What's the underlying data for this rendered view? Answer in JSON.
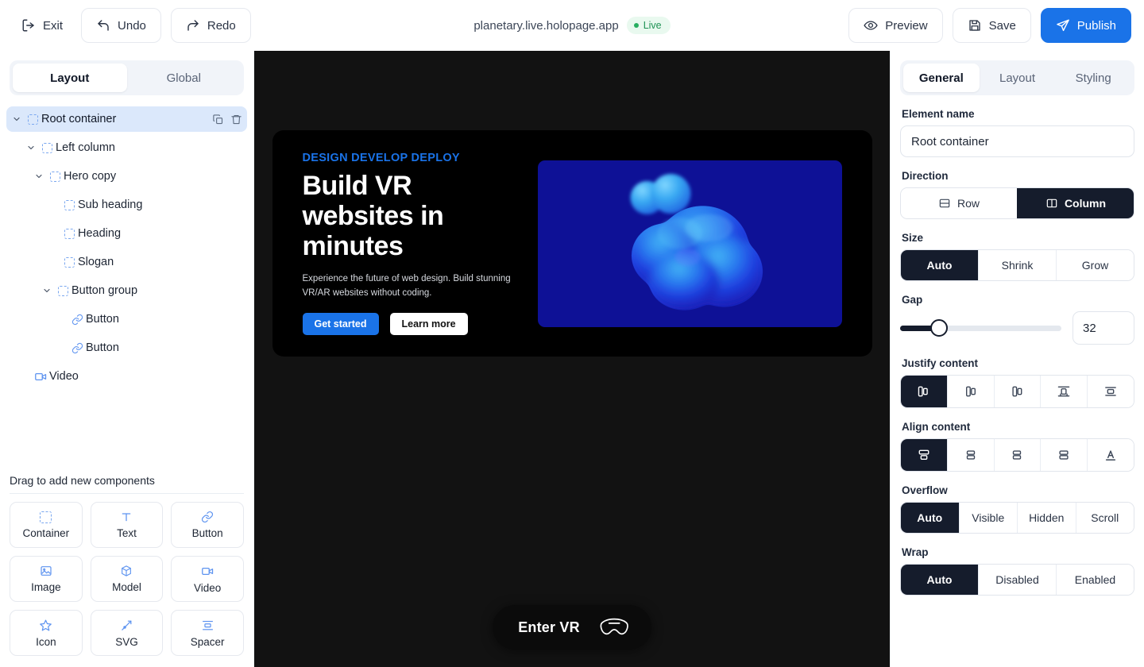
{
  "topbar": {
    "exit_label": "Exit",
    "undo_label": "Undo",
    "redo_label": "Redo",
    "url": "planetary.live.holopage.app",
    "live_label": "Live",
    "preview_label": "Preview",
    "save_label": "Save",
    "publish_label": "Publish",
    "accent": "#1a73e8",
    "live_color": "#1f9254"
  },
  "left_panel": {
    "tabs": [
      {
        "label": "Layout",
        "active": true
      },
      {
        "label": "Global",
        "active": false
      }
    ],
    "tree": [
      {
        "label": "Root container",
        "icon": "container-icon",
        "depth": 0,
        "caret": "chevron-down-icon",
        "selected": true,
        "actions": [
          "duplicate-icon",
          "delete-icon"
        ]
      },
      {
        "label": "Left column",
        "icon": "container-icon",
        "depth": 1,
        "caret": "chevron-down-icon",
        "selected": false
      },
      {
        "label": "Hero copy",
        "icon": "container-icon",
        "depth": 2,
        "caret": "chevron-down-icon",
        "selected": false
      },
      {
        "label": "Sub heading",
        "icon": "container-icon",
        "depth": 3,
        "caret": "",
        "selected": false
      },
      {
        "label": "Heading",
        "icon": "container-icon",
        "depth": 3,
        "caret": "",
        "selected": false
      },
      {
        "label": "Slogan",
        "icon": "container-icon",
        "depth": 3,
        "caret": "",
        "selected": false
      },
      {
        "label": "Button group",
        "icon": "container-icon",
        "depth": 2,
        "caret": "chevron-down-icon",
        "selected": false
      },
      {
        "label": "Button",
        "icon": "link-icon",
        "depth": 3,
        "caret": "",
        "selected": false
      },
      {
        "label": "Button",
        "icon": "link-icon",
        "depth": 3,
        "caret": "",
        "selected": false
      },
      {
        "label": "Video",
        "icon": "video-icon",
        "depth": 0,
        "caret": "",
        "selected": false
      }
    ],
    "add_components": {
      "title": "Drag to add new components",
      "items": [
        {
          "label": "Container",
          "icon": "container-icon"
        },
        {
          "label": "Text",
          "icon": "text-icon"
        },
        {
          "label": "Button",
          "icon": "link-icon"
        },
        {
          "label": "Image",
          "icon": "image-icon"
        },
        {
          "label": "Model",
          "icon": "cube-icon"
        },
        {
          "label": "Video",
          "icon": "video-icon"
        },
        {
          "label": "Icon",
          "icon": "star-icon"
        },
        {
          "label": "SVG",
          "icon": "pen-icon"
        },
        {
          "label": "Spacer",
          "icon": "spacer-icon"
        }
      ]
    }
  },
  "canvas": {
    "background": "#121212",
    "hero": {
      "card_background": "#000000",
      "eyebrow": "DESIGN DEVELOP DEPLOY",
      "heading": "Build VR websites in minutes",
      "slogan": "Experience the future of web design. Build stunning VR/AR websites without coding.",
      "primary_button": "Get started",
      "secondary_button": "Learn more",
      "media_background": "#0e1196",
      "media_alt": "blue-3d-blob"
    },
    "enter_vr": {
      "label": "Enter VR",
      "icon": "vr-headset-icon"
    }
  },
  "right_panel": {
    "tabs": [
      {
        "label": "General",
        "active": true
      },
      {
        "label": "Layout",
        "active": false
      },
      {
        "label": "Styling",
        "active": false
      }
    ],
    "element_name": {
      "label": "Element name",
      "value": "Root container",
      "placeholder": "Element name"
    },
    "direction": {
      "label": "Direction",
      "options": [
        {
          "label": "Row",
          "icon": "row-icon",
          "active": false
        },
        {
          "label": "Column",
          "icon": "column-icon",
          "active": true
        }
      ]
    },
    "size": {
      "label": "Size",
      "options": [
        {
          "label": "Auto",
          "active": true
        },
        {
          "label": "Shrink",
          "active": false
        },
        {
          "label": "Grow",
          "active": false
        }
      ]
    },
    "gap": {
      "label": "Gap",
      "value": "32",
      "percent": 24
    },
    "justify_content": {
      "label": "Justify content",
      "options": [
        {
          "icon": "justify-start-icon",
          "active": true
        },
        {
          "icon": "justify-center-icon",
          "active": false
        },
        {
          "icon": "justify-end-icon",
          "active": false
        },
        {
          "icon": "justify-between-icon",
          "active": false
        },
        {
          "icon": "justify-around-icon",
          "active": false
        }
      ]
    },
    "align_content": {
      "label": "Align content",
      "options": [
        {
          "icon": "align-start-icon",
          "active": true
        },
        {
          "icon": "align-center-icon",
          "active": false
        },
        {
          "icon": "align-end-icon",
          "active": false
        },
        {
          "icon": "align-stretch-icon",
          "active": false
        },
        {
          "icon": "align-baseline-icon",
          "active": false
        }
      ]
    },
    "overflow": {
      "label": "Overflow",
      "options": [
        {
          "label": "Auto",
          "active": true
        },
        {
          "label": "Visible",
          "active": false
        },
        {
          "label": "Hidden",
          "active": false
        },
        {
          "label": "Scroll",
          "active": false
        }
      ]
    },
    "wrap": {
      "label": "Wrap",
      "options": [
        {
          "label": "Auto",
          "active": true
        },
        {
          "label": "Disabled",
          "active": false
        },
        {
          "label": "Enabled",
          "active": false
        }
      ]
    }
  }
}
